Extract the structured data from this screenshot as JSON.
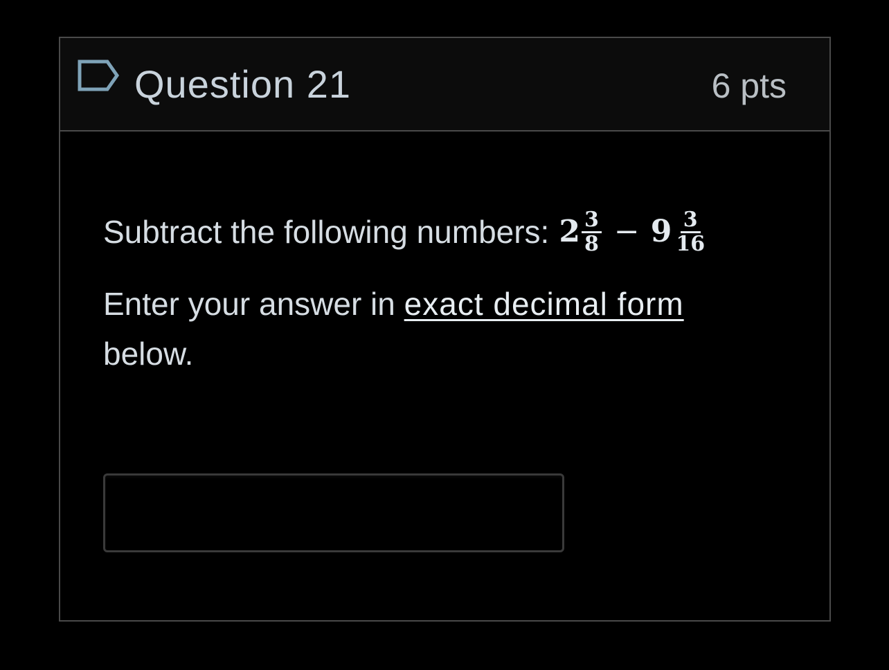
{
  "question": {
    "title": "Question 21",
    "points": "6 pts",
    "flag_icon": "flag-outline-icon"
  },
  "prompt": {
    "text": "Subtract the following numbers:",
    "expression": {
      "first_whole": "2",
      "first_numerator": "3",
      "first_denominator": "8",
      "operator": "−",
      "second_whole": "9",
      "second_numerator": "3",
      "second_denominator": "16"
    }
  },
  "instruction": {
    "before": "Enter your answer in",
    "emphasis": "exact decimal form",
    "after": "below."
  },
  "answer": {
    "value": "",
    "placeholder": ""
  },
  "colors": {
    "background": "#000000",
    "header_bg": "#0c0c0c",
    "border": "#4a4a4a",
    "text": "#d6dde3",
    "flag": "#7fa3b8"
  }
}
